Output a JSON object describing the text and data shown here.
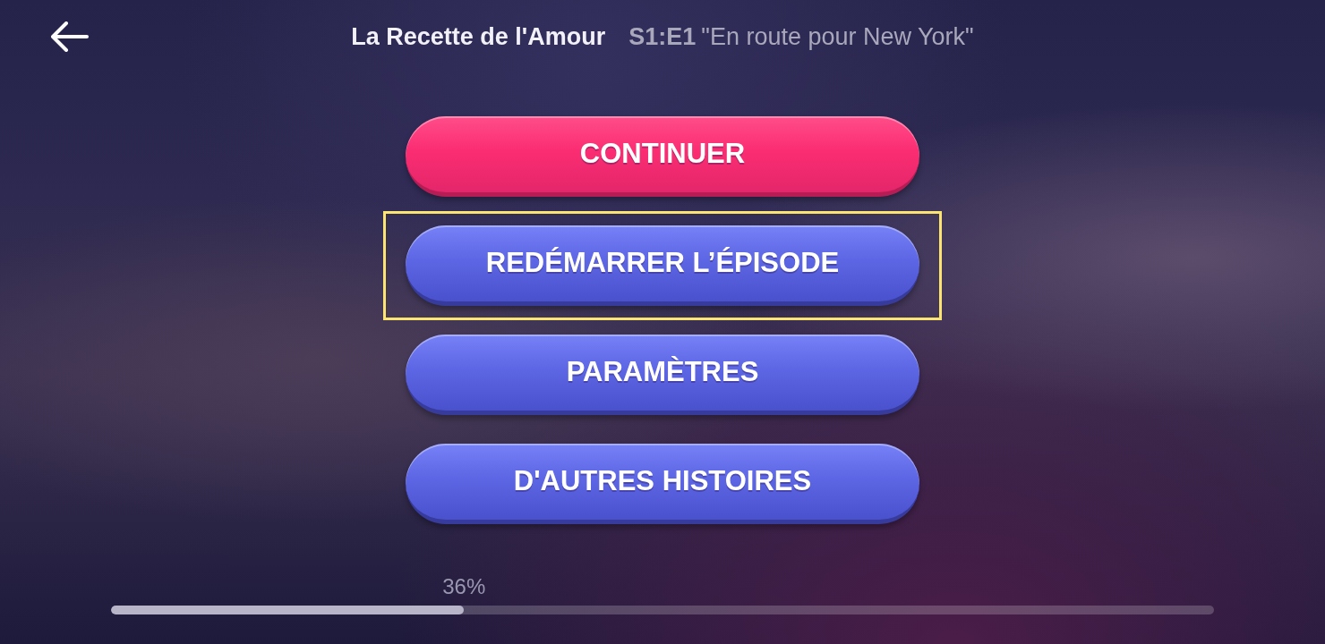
{
  "header": {
    "title": "La Recette de l'Amour",
    "episode_code": "S1:E1",
    "episode_title": "\"En route pour New York\""
  },
  "buttons": [
    {
      "label": "CONTINUER",
      "kind": "primary",
      "selected": false
    },
    {
      "label": "REDÉMARRER L’ÉPISODE",
      "kind": "secondary",
      "selected": true
    },
    {
      "label": "PARAMÈTRES",
      "kind": "secondary",
      "selected": false
    },
    {
      "label": "D'AUTRES HISTOIRES",
      "kind": "secondary",
      "selected": false
    }
  ],
  "progress": {
    "label": "36%",
    "level": 0.32
  }
}
